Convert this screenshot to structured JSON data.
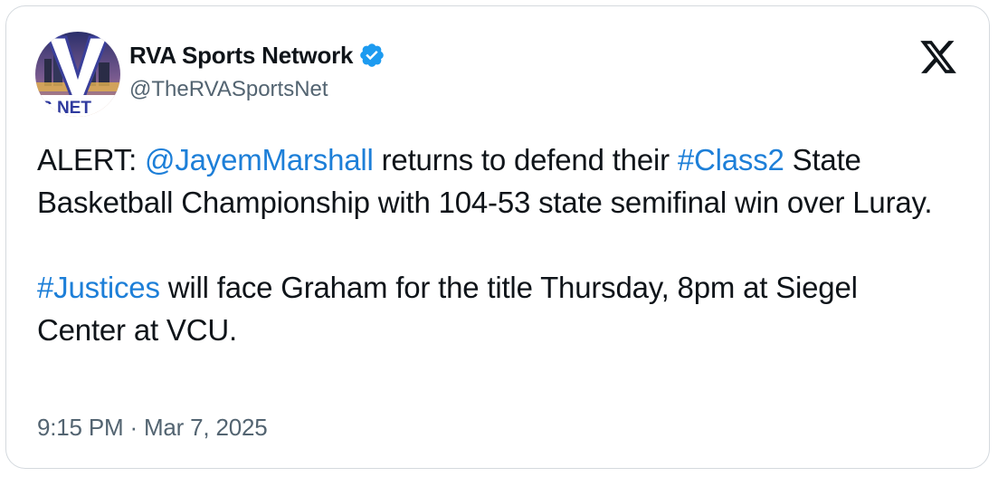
{
  "author": {
    "display_name": "RVA Sports Network",
    "handle": "@TheRVASportsNet",
    "verified": true,
    "avatar_text": "S NET"
  },
  "tweet": {
    "p1_lead": "ALERT: ",
    "p1_mention": "@JayemMarshall",
    "p1_mid": " returns to defend their ",
    "p1_hashtag": "#Class2",
    "p1_tail": " State Basketball Championship with 104-53 state semifinal win over Luray.",
    "p2_hashtag": "#Justices",
    "p2_tail": " will face Graham for the title Thursday, 8pm at Siegel Center at VCU."
  },
  "meta": {
    "time": "9:15 PM",
    "separator": " · ",
    "date": "Mar 7, 2025"
  },
  "colors": {
    "text": "#0f1419",
    "secondary": "#536471",
    "link": "#1d7fd8",
    "verified": "#1d9bf0"
  },
  "icons": {
    "platform": "x-logo-icon",
    "verified": "verified-badge-icon"
  }
}
